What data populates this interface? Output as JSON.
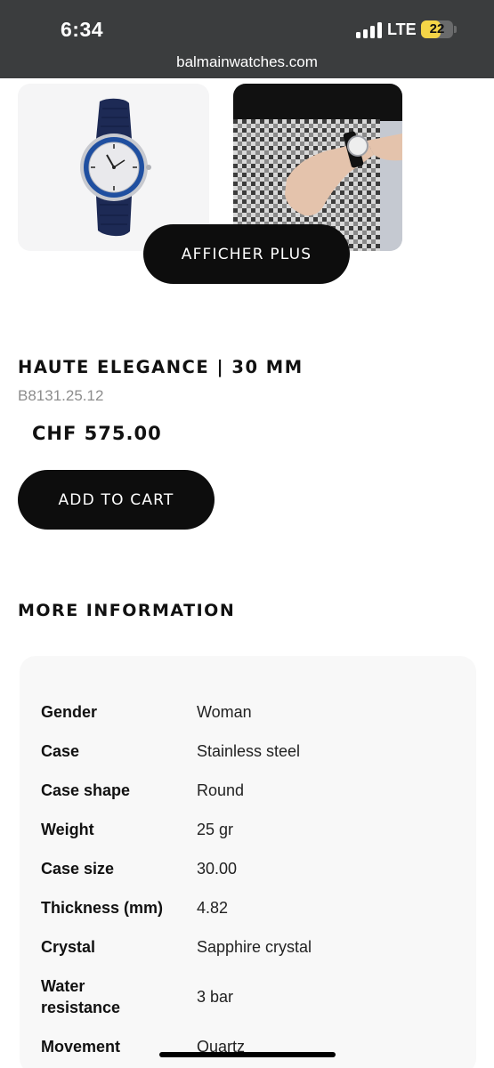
{
  "status_bar": {
    "time": "6:34",
    "network": "LTE",
    "battery": "22",
    "battery_fraction": 0.6,
    "signal_icon": "signal-bars-icon"
  },
  "browser": {
    "url": "balmainwatches.com"
  },
  "gallery": {
    "show_more_label": "AFFICHER PLUS",
    "images": [
      "watch-front-image",
      "watch-on-wrist-image"
    ]
  },
  "product": {
    "title": "HAUTE ELEGANCE | 30 MM",
    "sku": "B8131.25.12",
    "price": "CHF 575.00",
    "add_to_cart_label": "ADD TO CART"
  },
  "more_info": {
    "heading": "MORE INFORMATION",
    "rows": [
      {
        "label": "Gender",
        "value": "Woman"
      },
      {
        "label": "Case",
        "value": "Stainless steel"
      },
      {
        "label": "Case shape",
        "value": "Round"
      },
      {
        "label": "Weight",
        "value": "25 gr"
      },
      {
        "label": "Case size",
        "value": "30.00"
      },
      {
        "label": "Thickness (mm)",
        "value": "4.82"
      },
      {
        "label": "Crystal",
        "value": "Sapphire crystal"
      },
      {
        "label": "Water resistance",
        "value": "3 bar"
      },
      {
        "label": "Movement",
        "value": "Quartz"
      }
    ]
  },
  "colors": {
    "status_bar_bg": "#3b3d3e",
    "button_bg": "#0d0d0d",
    "battery_yellow": "#f5d547",
    "card_bg": "#f8f8f8"
  }
}
